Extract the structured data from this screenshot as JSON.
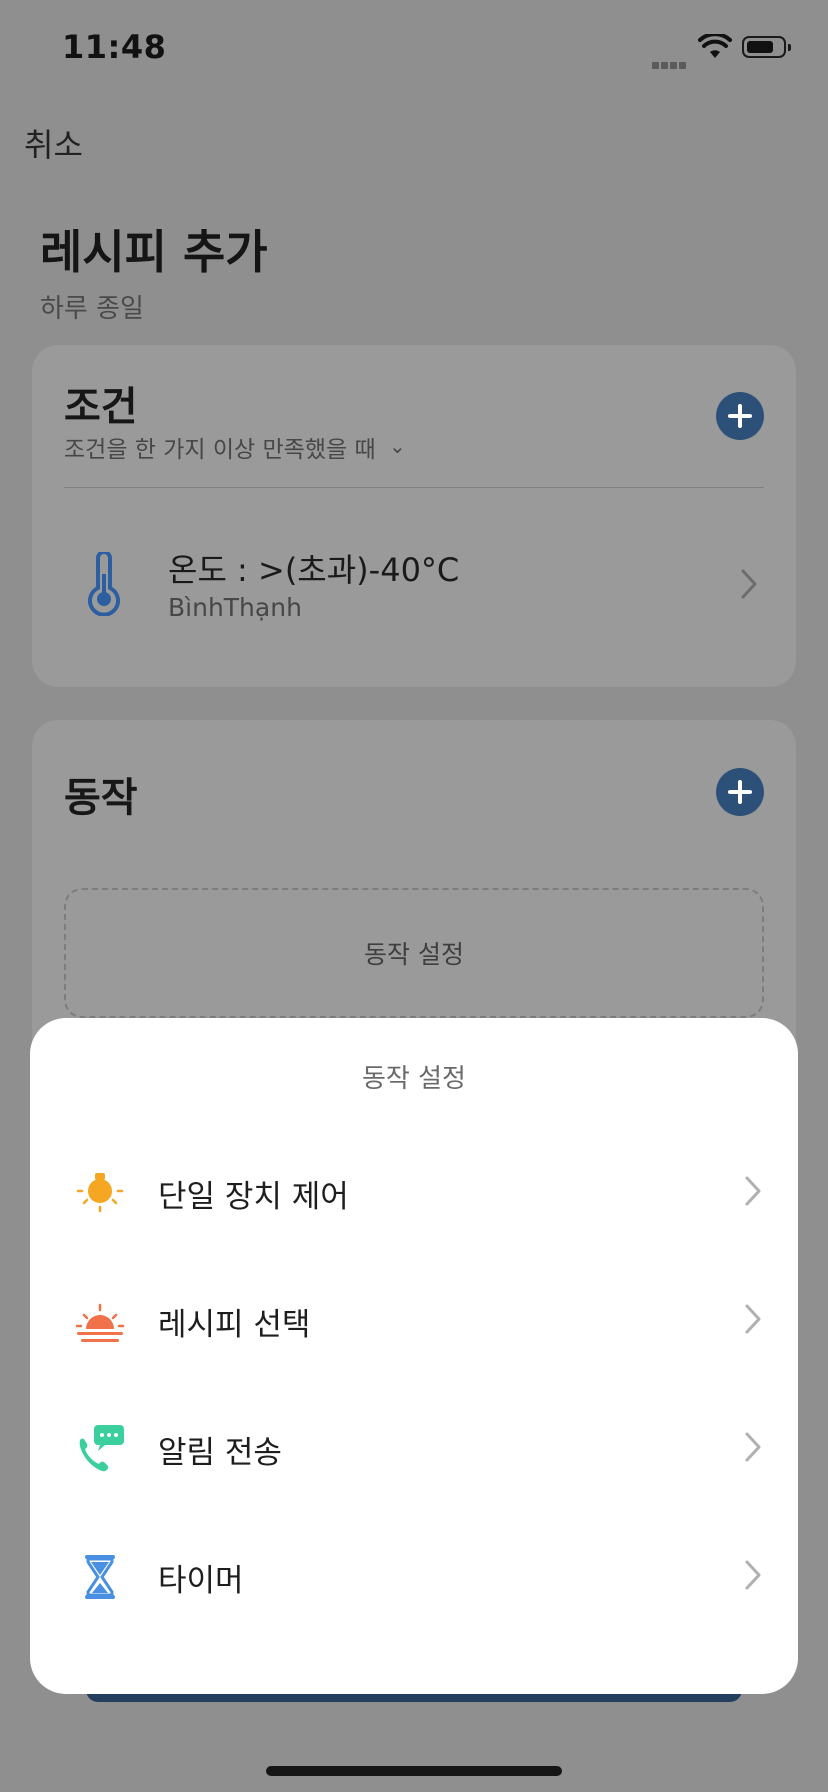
{
  "status_bar": {
    "time": "11:48"
  },
  "nav": {
    "cancel_label": "취소"
  },
  "header": {
    "title": "레시피 추가",
    "subtitle": "하루 종일"
  },
  "conditions": {
    "title": "조건",
    "mode_label": "조건을 한 가지 이상 만족했을 때",
    "mode_chevron": "⌄",
    "items": [
      {
        "text": "온도 : >(초과)-40°C",
        "location": "BìnhThạnh",
        "icon": "thermometer-icon"
      }
    ]
  },
  "actions": {
    "title": "동작",
    "placeholder_label": "동작 설정"
  },
  "sheet": {
    "title": "동작 설정",
    "options": [
      {
        "label": "단일 장치 제어",
        "icon": "bulb-icon",
        "color": "#f5a623"
      },
      {
        "label": "레시피 선택",
        "icon": "sunrise-icon",
        "color": "#f0714a"
      },
      {
        "label": "알림 전송",
        "icon": "phone-message-icon",
        "color": "#3ccf9e"
      },
      {
        "label": "타이머",
        "icon": "hourglass-icon",
        "color": "#4a90e2"
      }
    ]
  },
  "colors": {
    "accent": "#2d5078",
    "overlay_bg": "#8f8f8f"
  }
}
